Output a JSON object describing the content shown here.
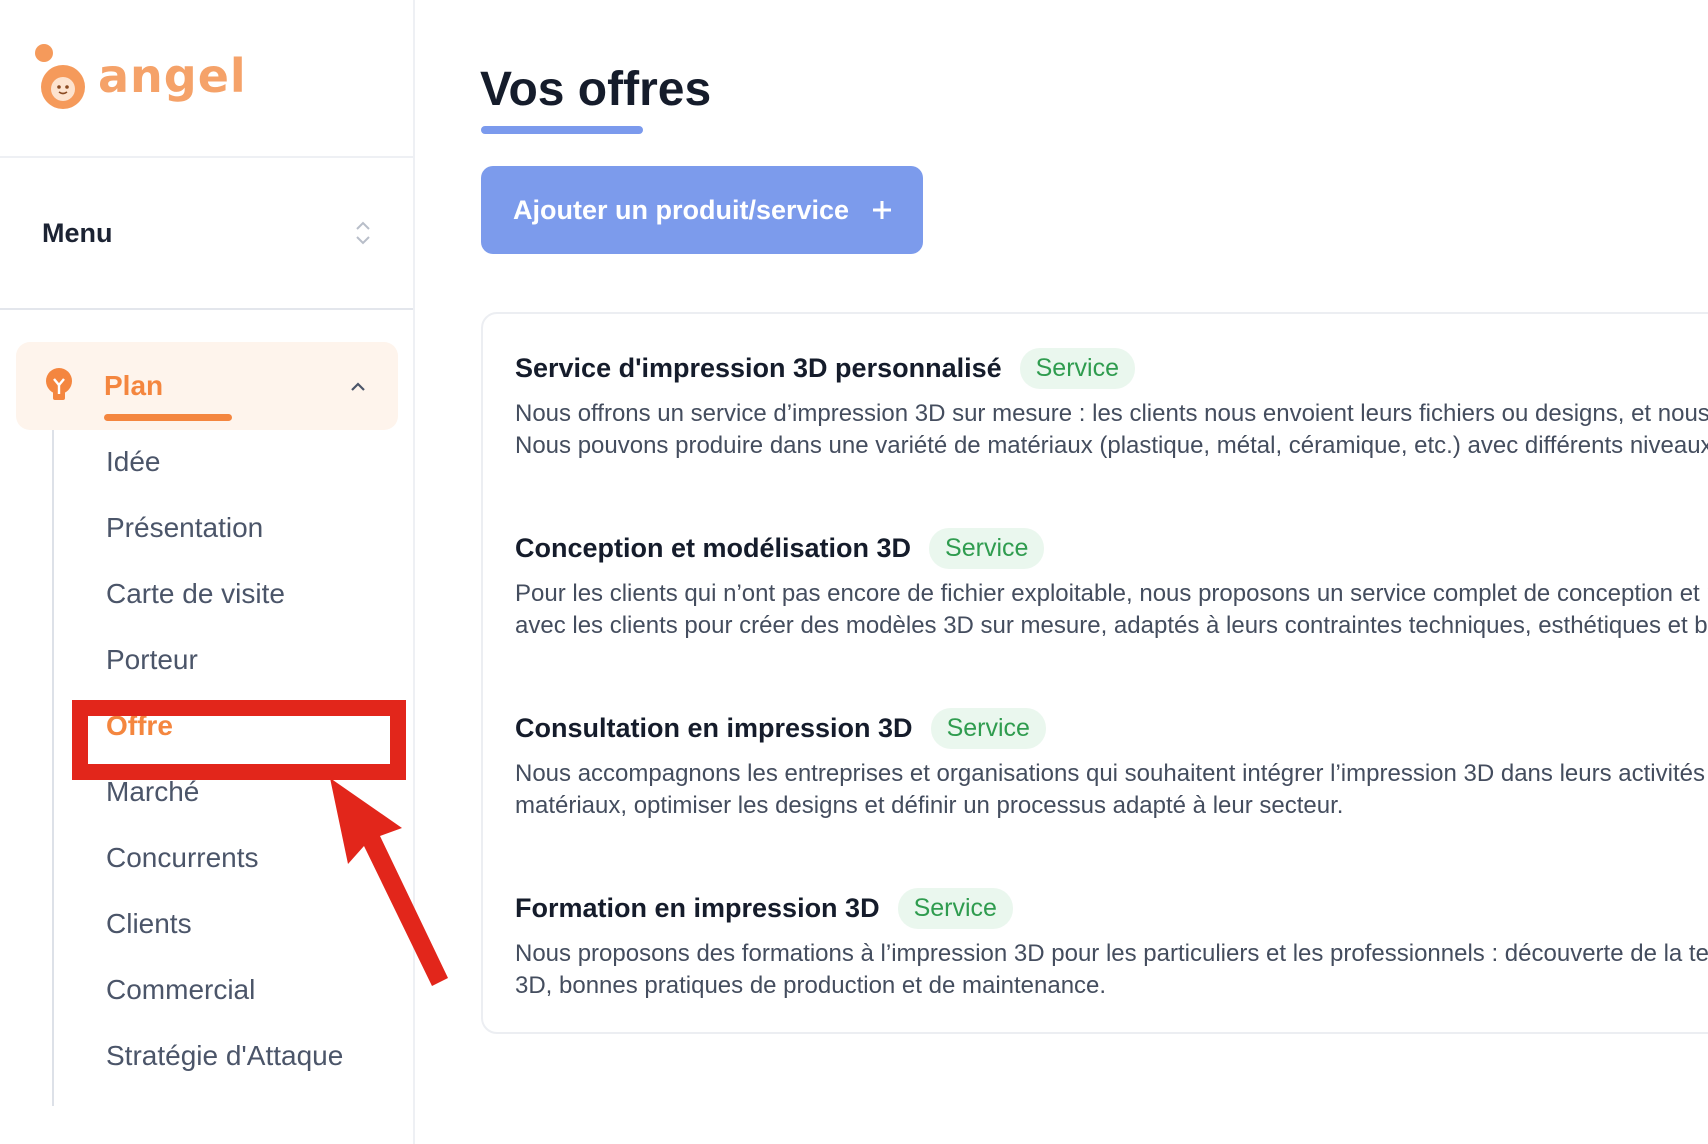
{
  "brand": {
    "name": "angel",
    "color": "#f4863f"
  },
  "sidebar": {
    "menu_label": "Menu",
    "section": {
      "label": "Plan",
      "expanded": true
    },
    "items": [
      {
        "label": "Idée"
      },
      {
        "label": "Présentation"
      },
      {
        "label": "Carte de visite"
      },
      {
        "label": "Porteur"
      },
      {
        "label": "Offre",
        "active": true
      },
      {
        "label": "Marché"
      },
      {
        "label": "Concurrents"
      },
      {
        "label": "Clients"
      },
      {
        "label": "Commercial"
      },
      {
        "label": "Stratégie d'Attaque"
      }
    ]
  },
  "main": {
    "title": "Vos offres",
    "add_button_label": "Ajouter un produit/service",
    "offers": [
      {
        "title": "Service d'impression 3D personnalisé",
        "badge": "Service",
        "line1": "Nous offrons un service d’impression 3D sur mesure : les clients nous envoient leurs fichiers ou designs, et nous",
        "line2": "Nous pouvons produire dans une variété de matériaux (plastique, métal, céramique, etc.) avec différents niveaux"
      },
      {
        "title": "Conception et modélisation 3D",
        "badge": "Service",
        "line1": "Pour les clients qui n’ont pas encore de fichier exploitable, nous proposons un service complet de conception et r",
        "line2": "avec les clients pour créer des modèles 3D sur mesure, adaptés à leurs contraintes techniques, esthétiques et bu"
      },
      {
        "title": "Consultation en impression 3D",
        "badge": "Service",
        "line1": "Nous accompagnons les entreprises et organisations qui souhaitent intégrer l’impression 3D dans leurs activités",
        "line2": "matériaux, optimiser les designs et définir un processus adapté à leur secteur."
      },
      {
        "title": "Formation en impression 3D",
        "badge": "Service",
        "line1": "Nous proposons des formations à l’impression 3D pour les particuliers et les professionnels : découverte de la te",
        "line2": "3D, bonnes pratiques de production et de maintenance."
      }
    ]
  },
  "colors": {
    "accent_orange": "#f4863f",
    "accent_blue": "#7c9bec",
    "badge_green": "#2f9c4f",
    "annotation_red": "#e2261b"
  }
}
